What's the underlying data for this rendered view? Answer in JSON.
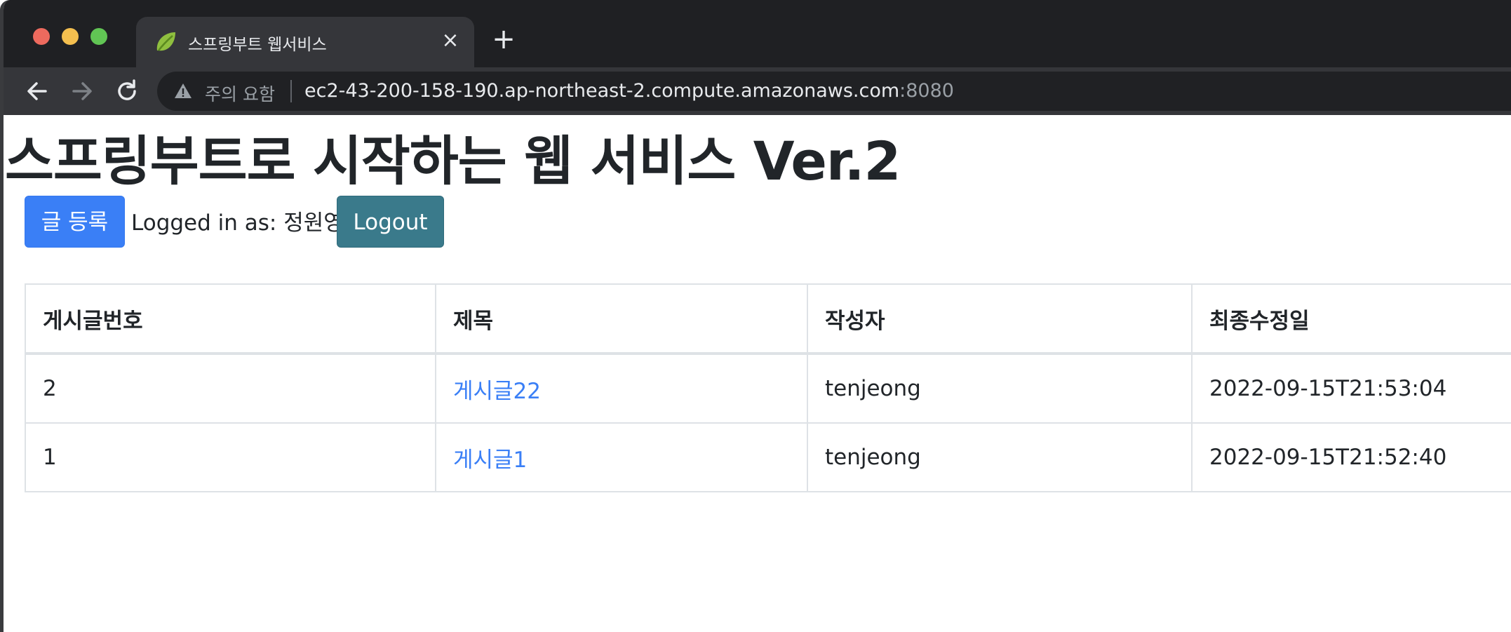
{
  "browser": {
    "tab_title": "스프링부트 웹서비스",
    "security_label": "주의 요함",
    "url_host": "ec2-43-200-158-190.ap-northeast-2.compute.amazonaws.com",
    "url_port": ":8080"
  },
  "page": {
    "title": "스프링부트로 시작하는 웹 서비스 Ver.2",
    "new_post_label": "글 등록",
    "logged_in_text": "Logged in as: 정원영",
    "logout_label": "Logout",
    "table": {
      "headers": [
        "게시글번호",
        "제목",
        "작성자",
        "최종수정일"
      ],
      "rows": [
        {
          "id": "2",
          "title": "게시글22",
          "author": "tenjeong",
          "modified": "2022-09-15T21:53:04"
        },
        {
          "id": "1",
          "title": "게시글1",
          "author": "tenjeong",
          "modified": "2022-09-15T21:52:40"
        }
      ]
    }
  },
  "colors": {
    "primary": "#3a7ff6",
    "logout": "#3a7a8b",
    "chrome_dark": "#1f2023",
    "chrome_tab": "#35363a"
  }
}
